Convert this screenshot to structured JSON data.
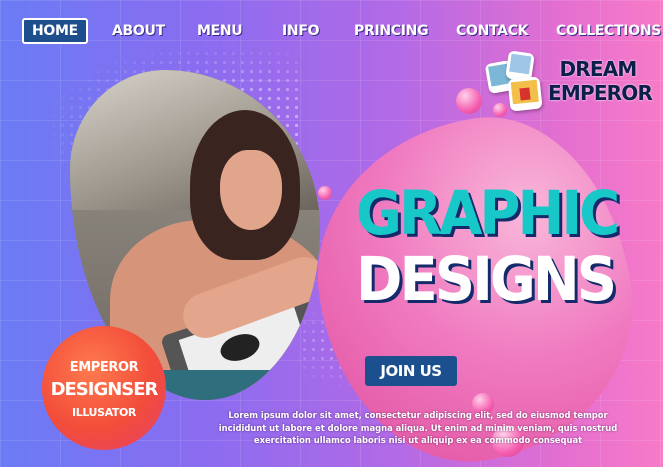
{
  "nav": {
    "items": [
      {
        "label": "HOME",
        "active": true
      },
      {
        "label": "ABOUT",
        "active": false
      },
      {
        "label": "MENU",
        "active": false
      },
      {
        "label": "INFO",
        "active": false
      },
      {
        "label": "PRINCING",
        "active": false
      },
      {
        "label": "CONTACK",
        "active": false
      },
      {
        "label": "COLLECTIONS",
        "active": false
      }
    ]
  },
  "logo": {
    "line1": "DREAM",
    "line2": "EMPEROR",
    "icon": "photo-collage-icon"
  },
  "hero": {
    "headline_line1": "GRAPHIC",
    "headline_line2": "DESIGNS",
    "cta_label": "JOIN US"
  },
  "badge": {
    "line1": "EMPEROR",
    "line2": "DESIGNSER",
    "line3": "ILLUSATOR"
  },
  "description": "Lorem ipsum dolor sit amet, consectetur adipiscing elit, sed do eiusmod tempor incididunt ut labore et dolore magna aliqua. Ut enim ad minim veniam, quis nostrud exercitation ullamco laboris nisi ut aliquip ex ea commodo consequat",
  "colors": {
    "accent_teal": "#18c8c8",
    "nav_active": "#1f4e8c",
    "badge": "#f24d3a",
    "cta": "#1c4f8e"
  }
}
